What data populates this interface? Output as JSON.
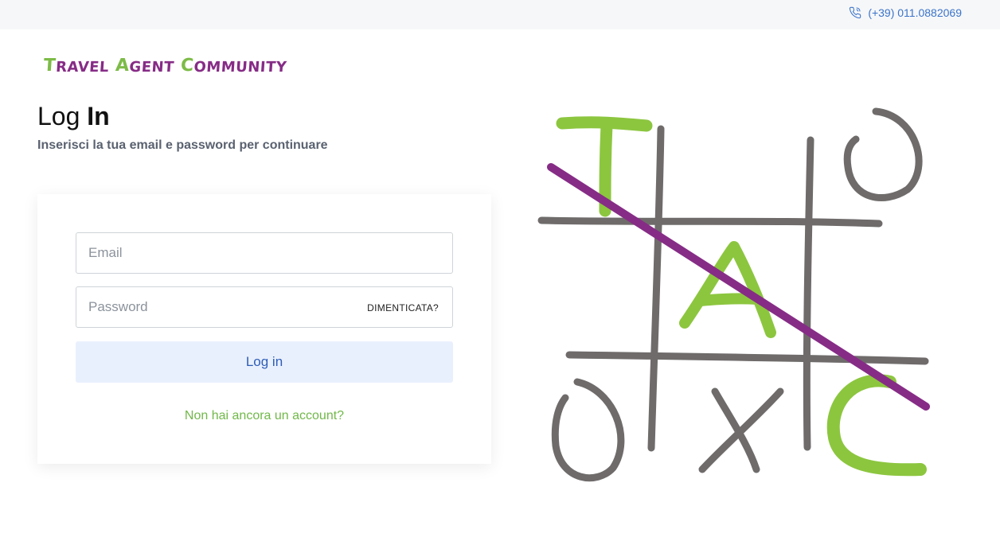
{
  "topbar": {
    "phone_icon": "phone-icon",
    "phone": "(+39) 011.0882069"
  },
  "logo": {
    "letters": [
      {
        "t": "T",
        "c": "#7dbb47",
        "size": "big"
      },
      {
        "t": "RAVEL",
        "c": "#862c86",
        "size": "small"
      },
      {
        "t": " ",
        "c": "#862c86",
        "size": "gap"
      },
      {
        "t": "A",
        "c": "#7dbb47",
        "size": "big"
      },
      {
        "t": "GENT",
        "c": "#862c86",
        "size": "small"
      },
      {
        "t": " ",
        "c": "#862c86",
        "size": "gap"
      },
      {
        "t": "C",
        "c": "#7dbb47",
        "size": "big"
      },
      {
        "t": "OMMUNITY",
        "c": "#862c86",
        "size": "small"
      }
    ]
  },
  "heading": {
    "light": "Log ",
    "bold": "In",
    "subtitle": "Inserisci la tua email e password per continuare"
  },
  "form": {
    "email_placeholder": "Email",
    "password_placeholder": "Password",
    "forgot_label": "DIMENTICATA?",
    "login_label": "Log in",
    "signup_label": "Non hai ancora un account?"
  },
  "art": {
    "letters": [
      "T",
      "A",
      "C"
    ],
    "o_marks": [
      "O",
      "O"
    ],
    "x_mark": "X",
    "colors": {
      "grid": "#6f6b6b",
      "green": "#8cc63f",
      "purple": "#862c86"
    }
  },
  "colors": {
    "accent_blue": "#3b74c9",
    "link_green": "#71b84a",
    "button_bg": "#e9f0fd"
  }
}
